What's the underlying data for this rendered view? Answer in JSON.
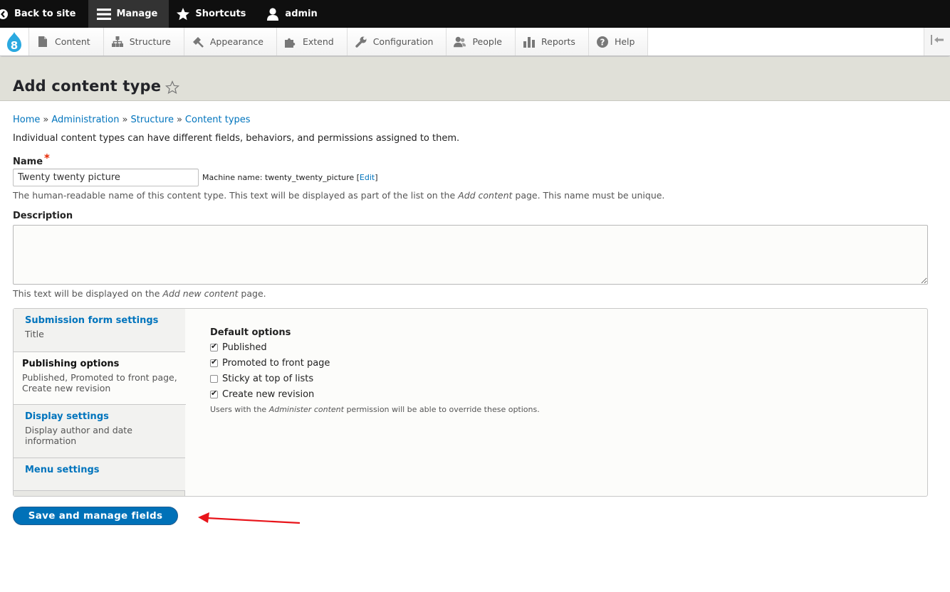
{
  "toolbar": {
    "back_label": "Back to site",
    "manage_label": "Manage",
    "shortcuts_label": "Shortcuts",
    "user_label": "admin"
  },
  "tray": {
    "items": [
      {
        "label": "Content",
        "icon": "document-icon"
      },
      {
        "label": "Structure",
        "icon": "sitemap-icon"
      },
      {
        "label": "Appearance",
        "icon": "paintbrush-icon"
      },
      {
        "label": "Extend",
        "icon": "puzzle-icon"
      },
      {
        "label": "Configuration",
        "icon": "wrench-icon"
      },
      {
        "label": "People",
        "icon": "people-icon"
      },
      {
        "label": "Reports",
        "icon": "bar-chart-icon"
      },
      {
        "label": "Help",
        "icon": "question-icon"
      }
    ]
  },
  "page": {
    "title": "Add content type"
  },
  "breadcrumb": [
    "Home",
    "Administration",
    "Structure",
    "Content types"
  ],
  "breadcrumb_separator": "»",
  "intro": "Individual content types can have different fields, behaviors, and permissions assigned to them.",
  "name_field": {
    "label": "Name",
    "required_mark": "*",
    "value": "Twenty twenty picture",
    "machine_prefix": "Machine name: twenty_twenty_picture [",
    "machine_edit": "Edit",
    "machine_suffix": "]",
    "help_before": "The human-readable name of this content type. This text will be displayed as part of the list on the ",
    "help_em": "Add content",
    "help_after": " page. This name must be unique."
  },
  "description_field": {
    "label": "Description",
    "value": "",
    "help_before": "This text will be displayed on the ",
    "help_em": "Add new content",
    "help_after": " page."
  },
  "vertical_tabs": [
    {
      "title": "Submission form settings",
      "summary": "Title"
    },
    {
      "title": "Publishing options",
      "summary": "Published, Promoted to front page, Create new revision"
    },
    {
      "title": "Display settings",
      "summary": "Display author and date information"
    },
    {
      "title": "Menu settings",
      "summary": ""
    }
  ],
  "publishing": {
    "title": "Default options",
    "options": [
      {
        "label": "Published",
        "checked": true
      },
      {
        "label": "Promoted to front page",
        "checked": true
      },
      {
        "label": "Sticky at top of lists",
        "checked": false
      },
      {
        "label": "Create new revision",
        "checked": true
      }
    ],
    "help_before": "Users with the ",
    "help_em": "Administer content",
    "help_after": " permission will be able to override these options."
  },
  "save_button": "Save and manage fields",
  "colors": {
    "link": "#0074bd",
    "button": "#0071b8",
    "required": "#e62600",
    "annotation_arrow": "#e8141a"
  }
}
